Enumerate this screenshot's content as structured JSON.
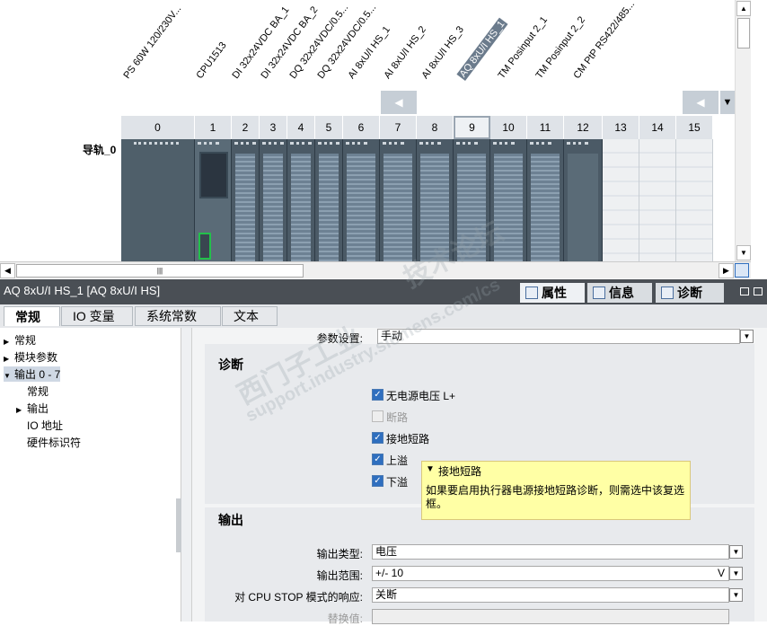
{
  "device_view": {
    "modules": [
      {
        "label": "PS 60W 120/230V...",
        "selected": false
      },
      {
        "label": "CPU1513",
        "selected": false
      },
      {
        "label": "DI 32x24VDC BA_1",
        "selected": false
      },
      {
        "label": "DI 32x24VDC BA_2",
        "selected": false
      },
      {
        "label": "DQ 32x24VDC/0.5...",
        "selected": false
      },
      {
        "label": "DQ 32x24VDC/0.5...",
        "selected": false
      },
      {
        "label": "AI 8xU/I HS_1",
        "selected": false
      },
      {
        "label": "AI 8xU/I HS_2",
        "selected": false
      },
      {
        "label": "AI 8xU/I HS_3",
        "selected": false
      },
      {
        "label": "AQ 8xU/I HS_1",
        "selected": true
      },
      {
        "label": "TM Posinput 2_1",
        "selected": false
      },
      {
        "label": "TM Posinput 2_2",
        "selected": false
      },
      {
        "label": "CM PtP RS422/485...",
        "selected": false
      }
    ],
    "slots": [
      "0",
      "1",
      "2",
      "3",
      "4",
      "5",
      "6",
      "7",
      "8",
      "9",
      "10",
      "11",
      "12",
      "13",
      "14",
      "15"
    ],
    "selected_slot": "9",
    "rail_label": "导轨_0",
    "arrow_left": "◀",
    "arrow_right": "▼"
  },
  "panel": {
    "title": "AQ 8xU/I HS_1 [AQ 8xU/I HS]",
    "view_tabs": [
      {
        "label": "属性",
        "active": true
      },
      {
        "label": "信息",
        "active": false
      },
      {
        "label": "诊断",
        "active": false
      }
    ]
  },
  "tabs": [
    {
      "label": "常规",
      "active": true
    },
    {
      "label": "IO 变量",
      "active": false
    },
    {
      "label": "系统常数",
      "active": false
    },
    {
      "label": "文本",
      "active": false
    }
  ],
  "tree": [
    {
      "label": "常规",
      "level": 0,
      "arrow": "▶"
    },
    {
      "label": "模块参数",
      "level": 0,
      "arrow": "▶"
    },
    {
      "label": "输出 0 - 7",
      "level": 0,
      "arrow": "▼",
      "selected": true
    },
    {
      "label": "常规",
      "level": 1,
      "arrow": ""
    },
    {
      "label": "输出",
      "level": 1,
      "arrow": "▶"
    },
    {
      "label": "IO 地址",
      "level": 1,
      "arrow": ""
    },
    {
      "label": "硬件标识符",
      "level": 1,
      "arrow": ""
    }
  ],
  "params": {
    "param_setting_label": "参数设置:",
    "param_setting_value": "手动",
    "diag_title": "诊断",
    "checkboxes": [
      {
        "label": "无电源电压 L+",
        "checked": true,
        "disabled": false
      },
      {
        "label": "断路",
        "checked": false,
        "disabled": true
      },
      {
        "label": "接地短路",
        "checked": true,
        "disabled": false
      },
      {
        "label": "上溢",
        "checked": true,
        "disabled": false
      },
      {
        "label": "下溢",
        "checked": true,
        "disabled": false
      }
    ],
    "output_title": "输出",
    "output_type_label": "输出类型:",
    "output_type_value": "电压",
    "output_range_label": "输出范围:",
    "output_range_value": "+/- 10",
    "output_range_unit": "V",
    "cpu_stop_label": "对 CPU STOP 模式的响应:",
    "cpu_stop_value": "关断",
    "subst_label": "替换值:"
  },
  "tooltip": {
    "title": "接地短路",
    "body": "如果要启用执行器电源接地短路诊断，则需选中该复选框。"
  },
  "watermark": {
    "line1": "西门子工业",
    "line2": "技术论坛",
    "line3": "support.industry.siemens.com/cs"
  },
  "colors": {
    "accent": "#2f6fbf",
    "tooltip_bg": "#ffffa5",
    "titlebar": "#4a4f55"
  }
}
